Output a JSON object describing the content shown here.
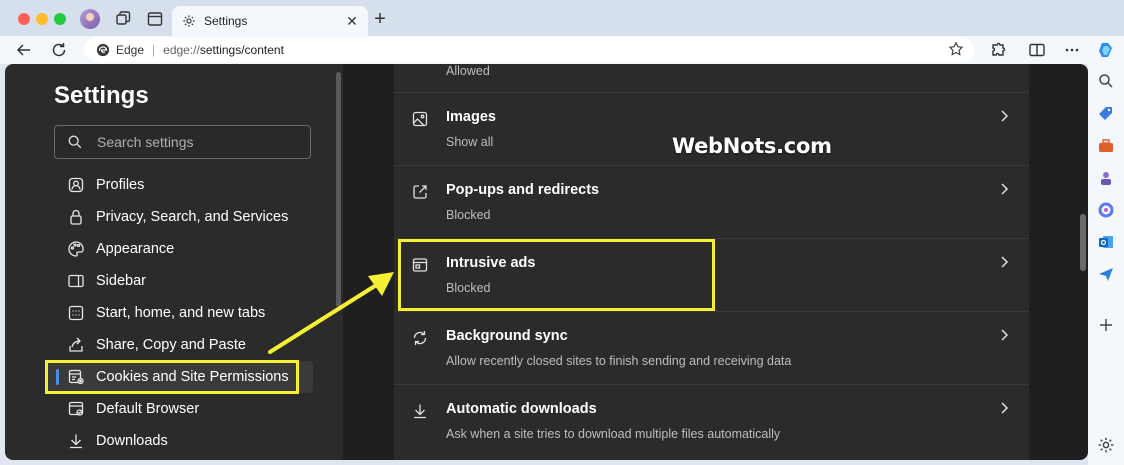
{
  "browser": {
    "tab_title": "Settings",
    "new_tab_symbol": "+",
    "close_symbol": "✕",
    "address_brand": "Edge",
    "address_scheme": "edge://",
    "address_path": "settings/content"
  },
  "settings": {
    "title": "Settings",
    "search_placeholder": "Search settings",
    "nav": [
      {
        "label": "Profiles",
        "icon": "profile-icon"
      },
      {
        "label": "Privacy, Search, and Services",
        "icon": "lock-icon"
      },
      {
        "label": "Appearance",
        "icon": "palette-icon"
      },
      {
        "label": "Sidebar",
        "icon": "sidebar-icon"
      },
      {
        "label": "Start, home, and new tabs",
        "icon": "home-tabs-icon"
      },
      {
        "label": "Share, Copy and Paste",
        "icon": "share-icon"
      },
      {
        "label": "Cookies and Site Permissions",
        "icon": "cookies-icon",
        "active": true
      },
      {
        "label": "Default Browser",
        "icon": "browser-icon"
      },
      {
        "label": "Downloads",
        "icon": "download-icon"
      }
    ]
  },
  "content": {
    "partial_row_sub": "Allowed",
    "rows": [
      {
        "title": "Images",
        "subtitle": "Show all",
        "icon": "image-icon"
      },
      {
        "title": "Pop-ups and redirects",
        "subtitle": "Blocked",
        "icon": "popup-icon"
      },
      {
        "title": "Intrusive ads",
        "subtitle": "Blocked",
        "icon": "ads-icon"
      },
      {
        "title": "Background sync",
        "subtitle": "Allow recently closed sites to finish sending and receiving data",
        "icon": "sync-icon"
      },
      {
        "title": "Automatic downloads",
        "subtitle": "Ask when a site tries to download multiple files automatically",
        "icon": "download-icon"
      }
    ]
  },
  "annotations": {
    "watermark": "WebNots.com",
    "highlight_color": "#f5f033"
  }
}
